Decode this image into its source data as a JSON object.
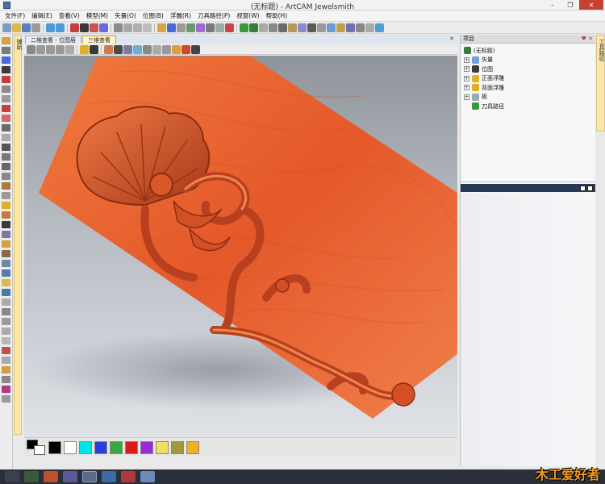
{
  "window": {
    "title": "(无标题) - ArtCAM Jewelsmith",
    "minimize": "–",
    "maximize": "❐",
    "close": "✕"
  },
  "menu": [
    "文件(F)",
    "编辑(E)",
    "查看(V)",
    "模型(M)",
    "矢量(O)",
    "位图(B)",
    "浮雕(R)",
    "刀具路径(P)",
    "视窗(W)",
    "帮助(H)"
  ],
  "view_tabs": [
    {
      "label": "二维查看 - 位图层",
      "active": false
    },
    {
      "label": "三维查看",
      "active": true
    }
  ],
  "view_tab_close": "✕",
  "left_tab_label": "辅助",
  "right_tab_label": "工具路径",
  "project_panel": {
    "title": "项目",
    "pin": "♥ ✕",
    "tree": [
      {
        "label": "(无标题)",
        "level": 0,
        "expander": "",
        "icon_color": "#3a7a3a"
      },
      {
        "label": "矢量",
        "level": 1,
        "expander": "+",
        "icon_color": "#6fa0d8"
      },
      {
        "label": "位图",
        "level": 1,
        "expander": "+",
        "icon_color": "#3b3b3b"
      },
      {
        "label": "正面浮雕",
        "level": 1,
        "expander": "+",
        "icon_color": "#e0b020"
      },
      {
        "label": "背面浮雕",
        "level": 1,
        "expander": "+",
        "icon_color": "#e0b020"
      },
      {
        "label": "板",
        "level": 1,
        "expander": "+",
        "icon_color": "#9aa8b8"
      },
      {
        "label": "刀具路径",
        "level": 1,
        "expander": "",
        "icon_color": "#3a9a3a"
      }
    ]
  },
  "palette": {
    "foreground": "#000000",
    "background": "#ffffff",
    "colors": [
      "#000000",
      "#ffffff",
      "#00e5e5",
      "#2b3fd6",
      "#3aa83a",
      "#d61c1c",
      "#9a2ad6",
      "#f0e060",
      "#a09a3a",
      "#f0b020"
    ]
  },
  "watermark": "木工爱好者",
  "colors": {
    "wood_light": "#e8662e",
    "wood_dark": "#b8401e",
    "taskbar": "#2a2f3a",
    "active_tab": "#fff6c8"
  }
}
